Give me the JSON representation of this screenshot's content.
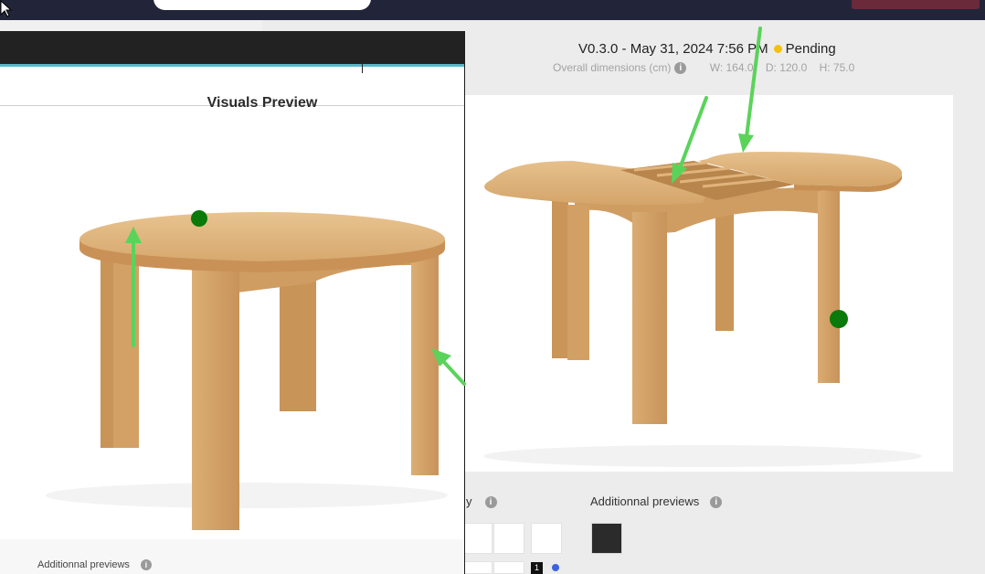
{
  "header": {
    "version_info": "V0.3.0 - May 31, 2024 7:56 PM",
    "status": "Pending",
    "status_color": "#f4c20d"
  },
  "dimensions": {
    "label": "Overall dimensions (cm)",
    "width": "W: 164.0",
    "depth": "D: 120.0",
    "height": "H: 75.0"
  },
  "main": {
    "gallery_label_fragment": "y",
    "additional_previews_label": "Additionnal previews",
    "count_badge": "1",
    "image_subject": "extendable round wooden table with leaf storage"
  },
  "overlay": {
    "title": "Visuals Preview",
    "additional_previews_label": "Additionnal previews",
    "image_subject": "round wooden table"
  },
  "icons": {
    "info": "info-icon",
    "cursor": "mouse-pointer-icon"
  },
  "colors": {
    "annotation_arrow": "#5ad35a",
    "annotation_dot": "#0a7a0a",
    "topbar": "#22253a",
    "accent_line": "#55b7c8",
    "dot_indicator": "#3b62e0"
  }
}
